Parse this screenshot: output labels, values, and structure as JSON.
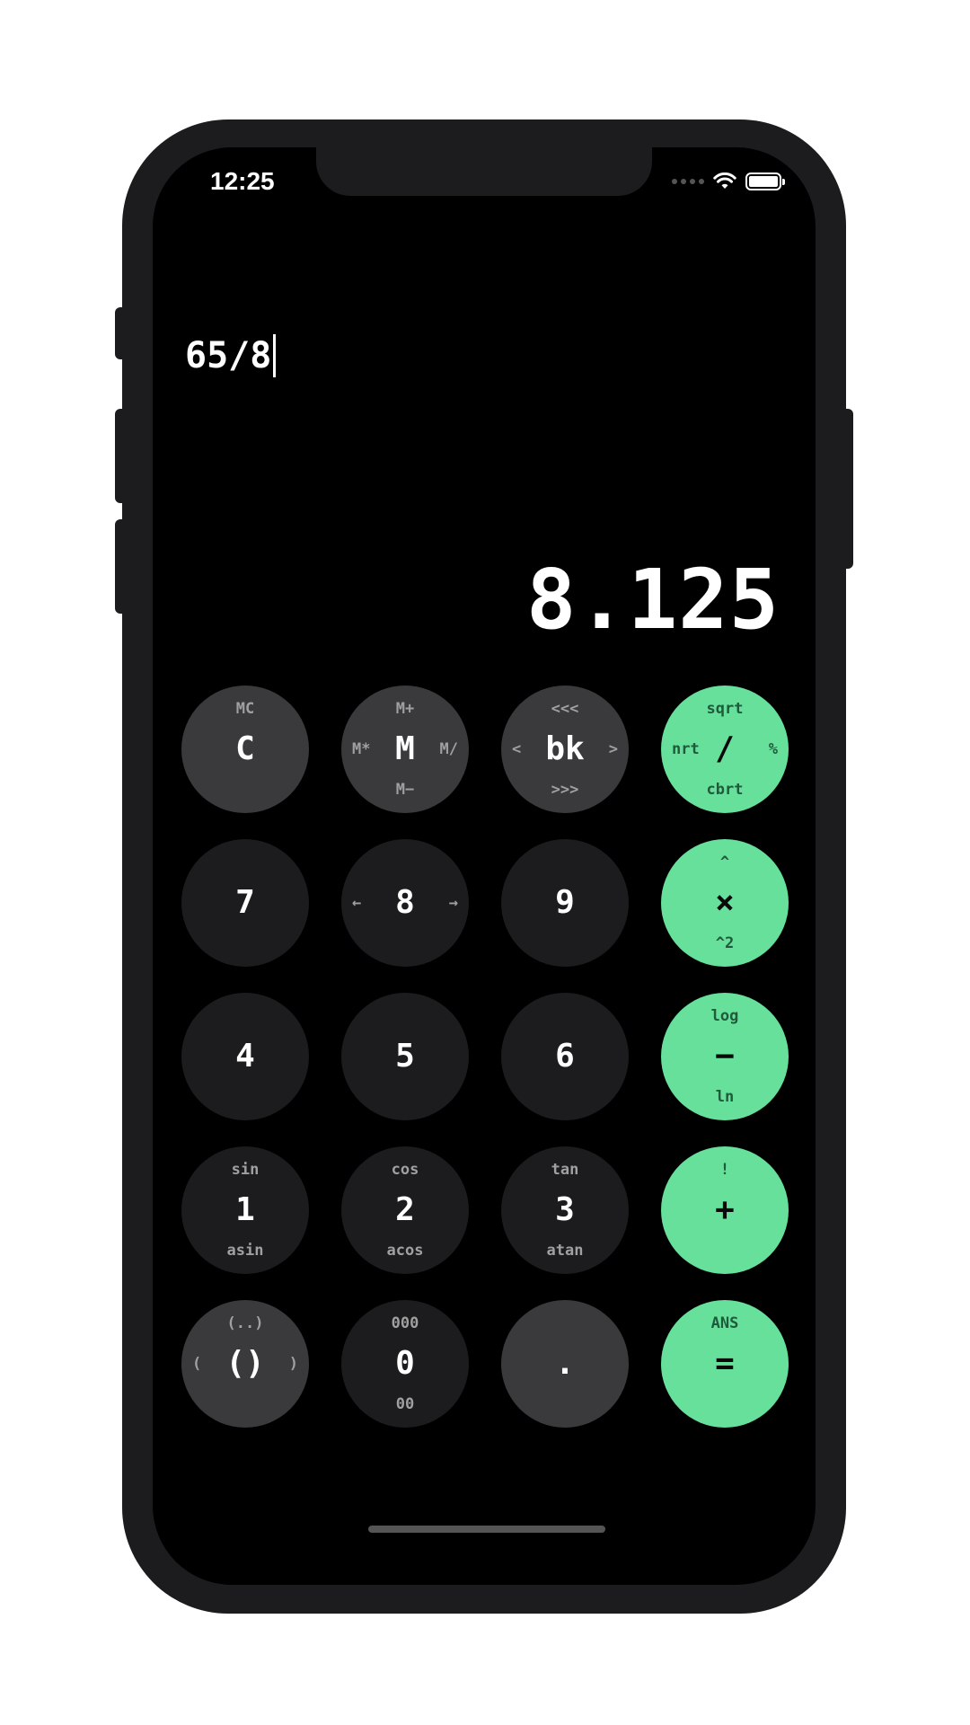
{
  "status_bar": {
    "time": "12:25"
  },
  "display": {
    "expression": "65/8",
    "result": "8.125"
  },
  "keys": [
    {
      "id": "clear",
      "main": "C",
      "top": "MC",
      "bottom": "",
      "left": "",
      "right": ""
    },
    {
      "id": "memory",
      "main": "M",
      "top": "M+",
      "bottom": "M−",
      "left": "M*",
      "right": "M/"
    },
    {
      "id": "backspace",
      "main": "bk",
      "top": "<<<",
      "bottom": ">>>",
      "left": "<",
      "right": ">"
    },
    {
      "id": "divide",
      "main": "/",
      "top": "sqrt",
      "bottom": "cbrt",
      "left": "nrt",
      "right": "%"
    },
    {
      "id": "seven",
      "main": "7",
      "top": "",
      "bottom": "",
      "left": "",
      "right": ""
    },
    {
      "id": "eight",
      "main": "8",
      "top": "",
      "bottom": "",
      "left": "←",
      "right": "→"
    },
    {
      "id": "nine",
      "main": "9",
      "top": "",
      "bottom": "",
      "left": "",
      "right": ""
    },
    {
      "id": "multiply",
      "main": "×",
      "top": "^",
      "bottom": "^2",
      "left": "",
      "right": ""
    },
    {
      "id": "four",
      "main": "4",
      "top": "",
      "bottom": "",
      "left": "",
      "right": ""
    },
    {
      "id": "five",
      "main": "5",
      "top": "",
      "bottom": "",
      "left": "",
      "right": ""
    },
    {
      "id": "six",
      "main": "6",
      "top": "",
      "bottom": "",
      "left": "",
      "right": ""
    },
    {
      "id": "minus",
      "main": "−",
      "top": "log",
      "bottom": "ln",
      "left": "",
      "right": ""
    },
    {
      "id": "one",
      "main": "1",
      "top": "sin",
      "bottom": "asin",
      "left": "",
      "right": ""
    },
    {
      "id": "two",
      "main": "2",
      "top": "cos",
      "bottom": "acos",
      "left": "",
      "right": ""
    },
    {
      "id": "three",
      "main": "3",
      "top": "tan",
      "bottom": "atan",
      "left": "",
      "right": ""
    },
    {
      "id": "plus",
      "main": "+",
      "top": "!",
      "bottom": "",
      "left": "",
      "right": ""
    },
    {
      "id": "parentheses",
      "main": "()",
      "top": "(..)",
      "bottom": "",
      "left": "(",
      "right": ")"
    },
    {
      "id": "zero",
      "main": "0",
      "top": "000",
      "bottom": "00",
      "left": "",
      "right": ""
    },
    {
      "id": "decimal",
      "main": ".",
      "top": "",
      "bottom": "",
      "left": "",
      "right": ""
    },
    {
      "id": "equals",
      "main": "=",
      "top": "ANS",
      "bottom": "",
      "left": "",
      "right": ""
    }
  ],
  "colors": {
    "screen_background": "#000000",
    "function_key": "#3a3a3c",
    "digit_key": "#1c1c1e",
    "operator_key": "#66e09b"
  },
  "icons": [
    "wifi-icon",
    "battery-icon",
    "signal-dots-icon"
  ]
}
